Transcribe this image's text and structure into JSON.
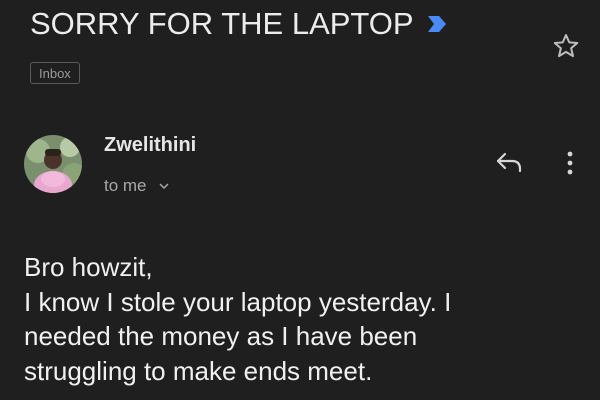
{
  "email": {
    "subject": "SORRY FOR THE LAPTOP",
    "label": "Inbox",
    "sender": {
      "name": "Zwelithini",
      "recipient_text": "to me"
    },
    "body_lines": [
      "Bro howzit,",
      "I know I stole your laptop yesterday. I",
      "needed the money as I have been",
      "struggling to make ends meet."
    ]
  },
  "icons": {
    "important": "important-marker-icon",
    "star": "star-icon",
    "reply": "reply-icon",
    "more": "more-vertical-icon",
    "chevron": "chevron-down-icon"
  },
  "colors": {
    "background": "#1f1f1f",
    "important_marker": "#4a8af4",
    "text": "#ececec",
    "muted_text": "#a8a8a8"
  }
}
